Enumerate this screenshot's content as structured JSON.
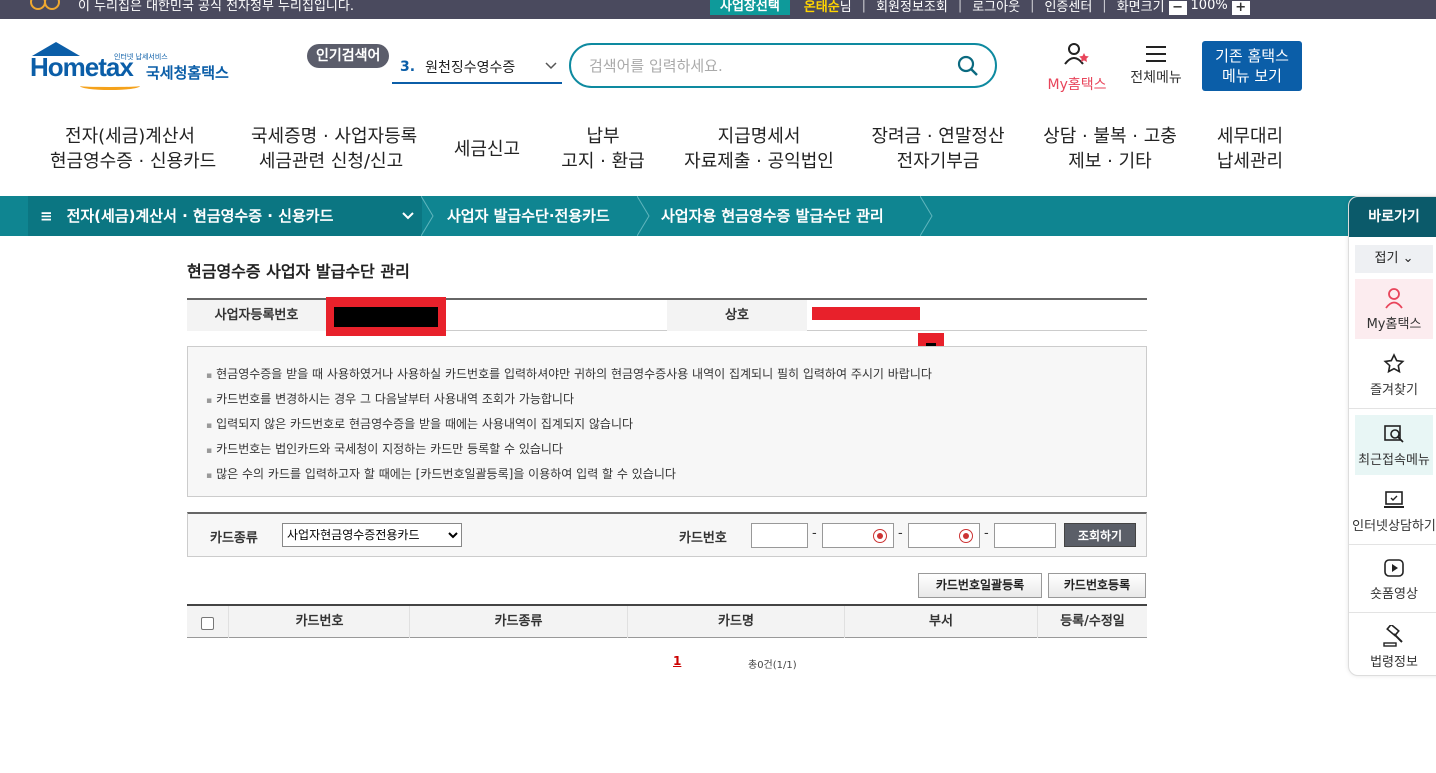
{
  "top_strip": {
    "gov_notice": "이 누리집은 대한민국 공식 전자정부 누리집입니다.",
    "select_label": "사업장선택",
    "user_name": "온태순",
    "user_suffix": "님",
    "links": [
      "회원정보조회",
      "로그아웃",
      "인증센터",
      "화면크기"
    ],
    "zoom": "100%",
    "zoom_out": "−",
    "zoom_in": "+"
  },
  "logo": {
    "brand": "Hometax",
    "tagline": "인터넷 납세서비스",
    "kr_name": "국세청홈택스"
  },
  "header": {
    "popular_tag": "인기검색어",
    "popular_rank": "3.",
    "popular_term": "원천징수영수증",
    "search_placeholder": "검색어를 입력하세요.",
    "my_hometax": "My홈택스",
    "all_menu": "전체메뉴",
    "old_menu_line1": "기존 홈택스",
    "old_menu_line2": "메뉴 보기"
  },
  "gnb": [
    {
      "l1": "전자(세금)계산서",
      "l2": "현금영수증 · 신용카드"
    },
    {
      "l1": "국세증명 · 사업자등록",
      "l2": "세금관련 신청/신고"
    },
    {
      "l1": "세금신고",
      "l2": ""
    },
    {
      "l1": "납부",
      "l2": "고지 · 환급"
    },
    {
      "l1": "지급명세서",
      "l2": "자료제출 · 공익법인"
    },
    {
      "l1": "장려금 · 연말정산",
      "l2": "전자기부금"
    },
    {
      "l1": "상담 · 불복 · 고충",
      "l2": "제보 · 기타"
    },
    {
      "l1": "세무대리",
      "l2": "납세관리"
    }
  ],
  "breadcrumb": {
    "menu_icon": "≡",
    "level1": "전자(세금)계산서 · 현금영수증 · 신용카드",
    "level2": "사업자 발급수단·전용카드",
    "level3": "사업자용 현금영수증 발급수단 관리"
  },
  "quick_menu": {
    "title": "바로가기",
    "fold": "접기",
    "items": [
      "My홈택스",
      "즐겨찾기",
      "최근접속메뉴",
      "인터넷상담하기",
      "숏폼영상",
      "법령정보"
    ]
  },
  "page": {
    "title": "현금영수증 사업자 발급수단 관리",
    "biz_no_label": "사업자등록번호",
    "company_label": "상호",
    "notices": [
      "현금영수증을 받을 때 사용하였거나 사용하실 카드번호를 입력하셔야만 귀하의 현금영수증사용 내역이 집계되니 필히 입력하여 주시기 바랍니다",
      "카드번호를 변경하시는 경우 그 다음날부터 사용내역 조회가 가능합니다",
      "입력되지 않은 카드번호로 현금영수증을 받을 때에는 사용내역이 집계되지 않습니다",
      "카드번호는 법인카드와 국세청이 지정하는 카드만 등록할 수 있습니다",
      "많은 수의 카드를 입력하고자 할 때에는 [카드번호일괄등록]을 이용하여 입력 할 수 있습니다"
    ],
    "card_type_label": "카드종류",
    "card_type_selected": "사업자현금영수증전용카드",
    "card_no_label": "카드번호",
    "search_button": "조회하기",
    "bulk_register_button": "카드번호일괄등록",
    "register_button": "카드번호등록",
    "columns": [
      "카드번호",
      "카드종류",
      "카드명",
      "부서",
      "등록/수정일"
    ],
    "pager_current": "1",
    "total_text": "총0건(1/1)"
  }
}
